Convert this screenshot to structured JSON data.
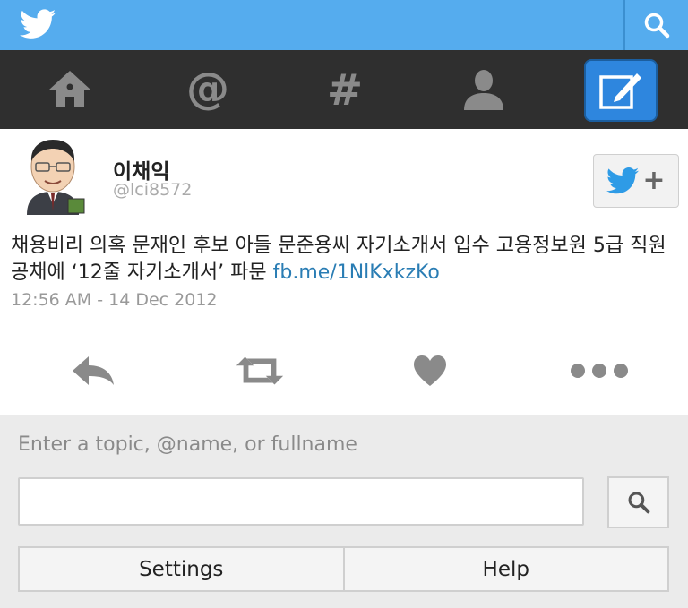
{
  "icons": {
    "bird": "twitter-bird-icon",
    "search": "search-icon",
    "home": "home-icon",
    "mentions": "at-icon",
    "discover": "hashtag-icon",
    "profile": "person-icon",
    "compose": "compose-icon",
    "follow": "follow-icon",
    "reply": "reply-icon",
    "retweet": "retweet-icon",
    "favorite": "heart-icon",
    "more": "more-icon"
  },
  "colors": {
    "brand": "#55acee",
    "navbar": "#2f2f2f",
    "compose_active": "#2e86de",
    "link": "#2a7db4"
  },
  "tweet": {
    "name": "이채익",
    "handle": "@lci8572",
    "text": "채용비리 의혹 문재인 후보 아들 문준용씨 자기소개서 입수 고용정보원 5급 직원 공채에 ‘12줄 자기소개서’ 파문 ",
    "link": "fb.me/1NlKxkzKo",
    "timestamp": "12:56 AM - 14 Dec 2012",
    "follow_plus": "+"
  },
  "search": {
    "hint": "Enter a topic, @name, or fullname",
    "value": ""
  },
  "buttons": {
    "settings": "Settings",
    "help": "Help"
  }
}
